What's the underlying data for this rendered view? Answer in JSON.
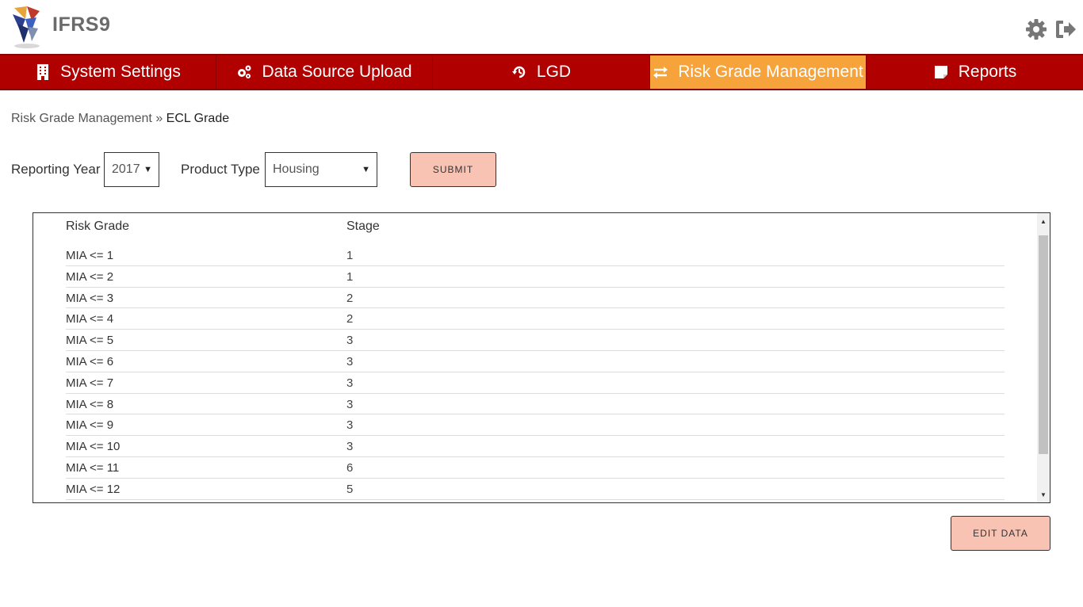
{
  "header": {
    "app_title": "IFRS9",
    "logo_icon": "ifrs9-logo",
    "settings_icon": "gear-icon",
    "logout_icon": "logout-icon"
  },
  "nav": {
    "items": [
      {
        "label": "System Settings",
        "icon": "building-icon",
        "active": false
      },
      {
        "label": "Data Source Upload",
        "icon": "cogs-icon",
        "active": false
      },
      {
        "label": "LGD",
        "icon": "history-icon",
        "active": false
      },
      {
        "label": "Risk Grade Management",
        "icon": "exchange-icon",
        "active": true
      },
      {
        "label": "Reports",
        "icon": "note-icon",
        "active": false
      }
    ],
    "colors": {
      "background": "#b00000",
      "active": "#f5a33a"
    }
  },
  "breadcrumb": {
    "parent": "Risk Grade Management",
    "separator": "»",
    "current": "ECL Grade"
  },
  "filters": {
    "reporting_year_label": "Reporting Year",
    "reporting_year_value": "2017",
    "product_type_label": "Product Type",
    "product_type_value": "Housing",
    "submit_label": "SUBMIT"
  },
  "table": {
    "headers": [
      "Risk Grade",
      "Stage"
    ],
    "rows": [
      {
        "grade": "MIA <= 1",
        "stage": "1"
      },
      {
        "grade": "MIA <= 2",
        "stage": "1"
      },
      {
        "grade": "MIA <= 3",
        "stage": "2"
      },
      {
        "grade": "MIA <= 4",
        "stage": "2"
      },
      {
        "grade": "MIA <= 5",
        "stage": "3"
      },
      {
        "grade": "MIA <= 6",
        "stage": "3"
      },
      {
        "grade": "MIA <= 7",
        "stage": "3"
      },
      {
        "grade": "MIA <= 8",
        "stage": "3"
      },
      {
        "grade": "MIA <= 9",
        "stage": "3"
      },
      {
        "grade": "MIA <= 10",
        "stage": "3"
      },
      {
        "grade": "MIA <= 11",
        "stage": "6"
      },
      {
        "grade": "MIA <= 12",
        "stage": "5"
      }
    ]
  },
  "actions": {
    "edit_label": "EDIT DATA",
    "button_color": "#f9c3b4"
  }
}
